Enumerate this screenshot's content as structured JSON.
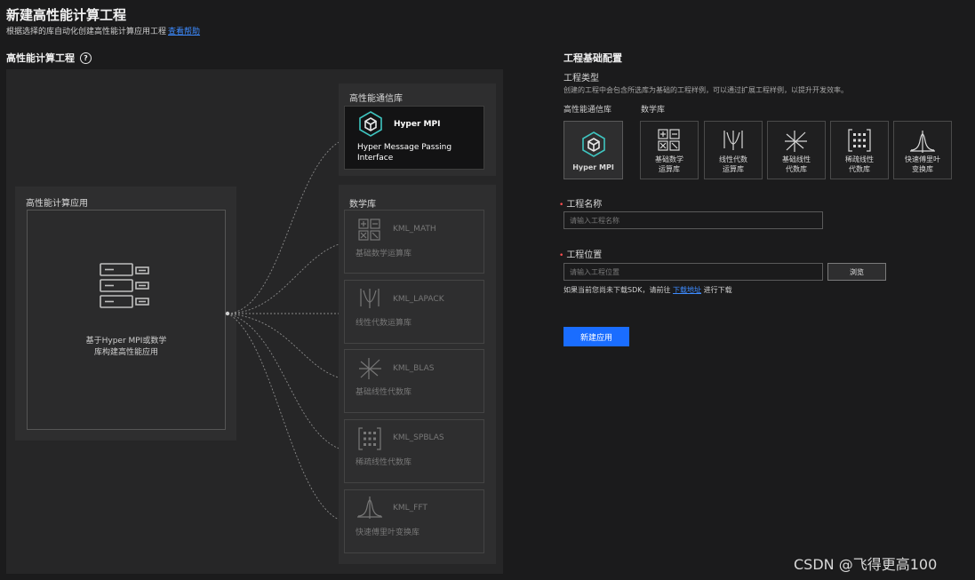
{
  "header": {
    "title": "新建高性能计算工程",
    "subtitle": "根据选择的库自动化创建高性能计算应用工程",
    "help_link": "查看帮助"
  },
  "diagram": {
    "section_title": "高性能计算工程",
    "app_panel_title": "高性能计算应用",
    "app_desc_line1": "基于Hyper MPI或数学",
    "app_desc_line2": "库构建高性能应用",
    "comm_lib_label": "高性能通信库",
    "math_lib_label": "数学库",
    "mpi": {
      "name": "Hyper MPI",
      "desc_line1": "Hyper Message Passing",
      "desc_line2": "Interface"
    },
    "kml": [
      {
        "name": "KML_MATH",
        "desc": "基础数学运算库"
      },
      {
        "name": "KML_LAPACK",
        "desc": "线性代数运算库"
      },
      {
        "name": "KML_BLAS",
        "desc": "基础线性代数库"
      },
      {
        "name": "KML_SPBLAS",
        "desc": "稀疏线性代数库"
      },
      {
        "name": "KML_FFT",
        "desc": "快速傅里叶变换库"
      }
    ]
  },
  "config": {
    "title": "工程基础配置",
    "project_type_label": "工程类型",
    "project_type_desc": "创建的工程中会包含所选库为基础的工程样例，可以通过扩展工程样例，以提升开发效率。",
    "comm_lib_label": "高性能通信库",
    "math_lib_label": "数学库",
    "types": [
      {
        "line1": "Hyper MPI",
        "line2": ""
      },
      {
        "line1": "基础数学",
        "line2": "运算库"
      },
      {
        "line1": "线性代数",
        "line2": "运算库"
      },
      {
        "line1": "基础线性",
        "line2": "代数库"
      },
      {
        "line1": "稀疏线性",
        "line2": "代数库"
      },
      {
        "line1": "快速傅里叶",
        "line2": "变换库"
      }
    ],
    "name_label": "工程名称",
    "name_placeholder": "请输入工程名称",
    "location_label": "工程位置",
    "location_placeholder": "请输入工程位置",
    "browse": "浏览",
    "sdk_hint_prefix": "如果当前您尚未下载SDK，请前往",
    "sdk_hint_link": "下载地址",
    "sdk_hint_suffix": "进行下载",
    "create_button": "新建应用"
  },
  "watermark": "CSDN @飞得更高100",
  "colors": {
    "background": "#1b1b1c",
    "accent": "#1a6dff",
    "link": "#3d8bff",
    "required": "#ff4d4f"
  }
}
